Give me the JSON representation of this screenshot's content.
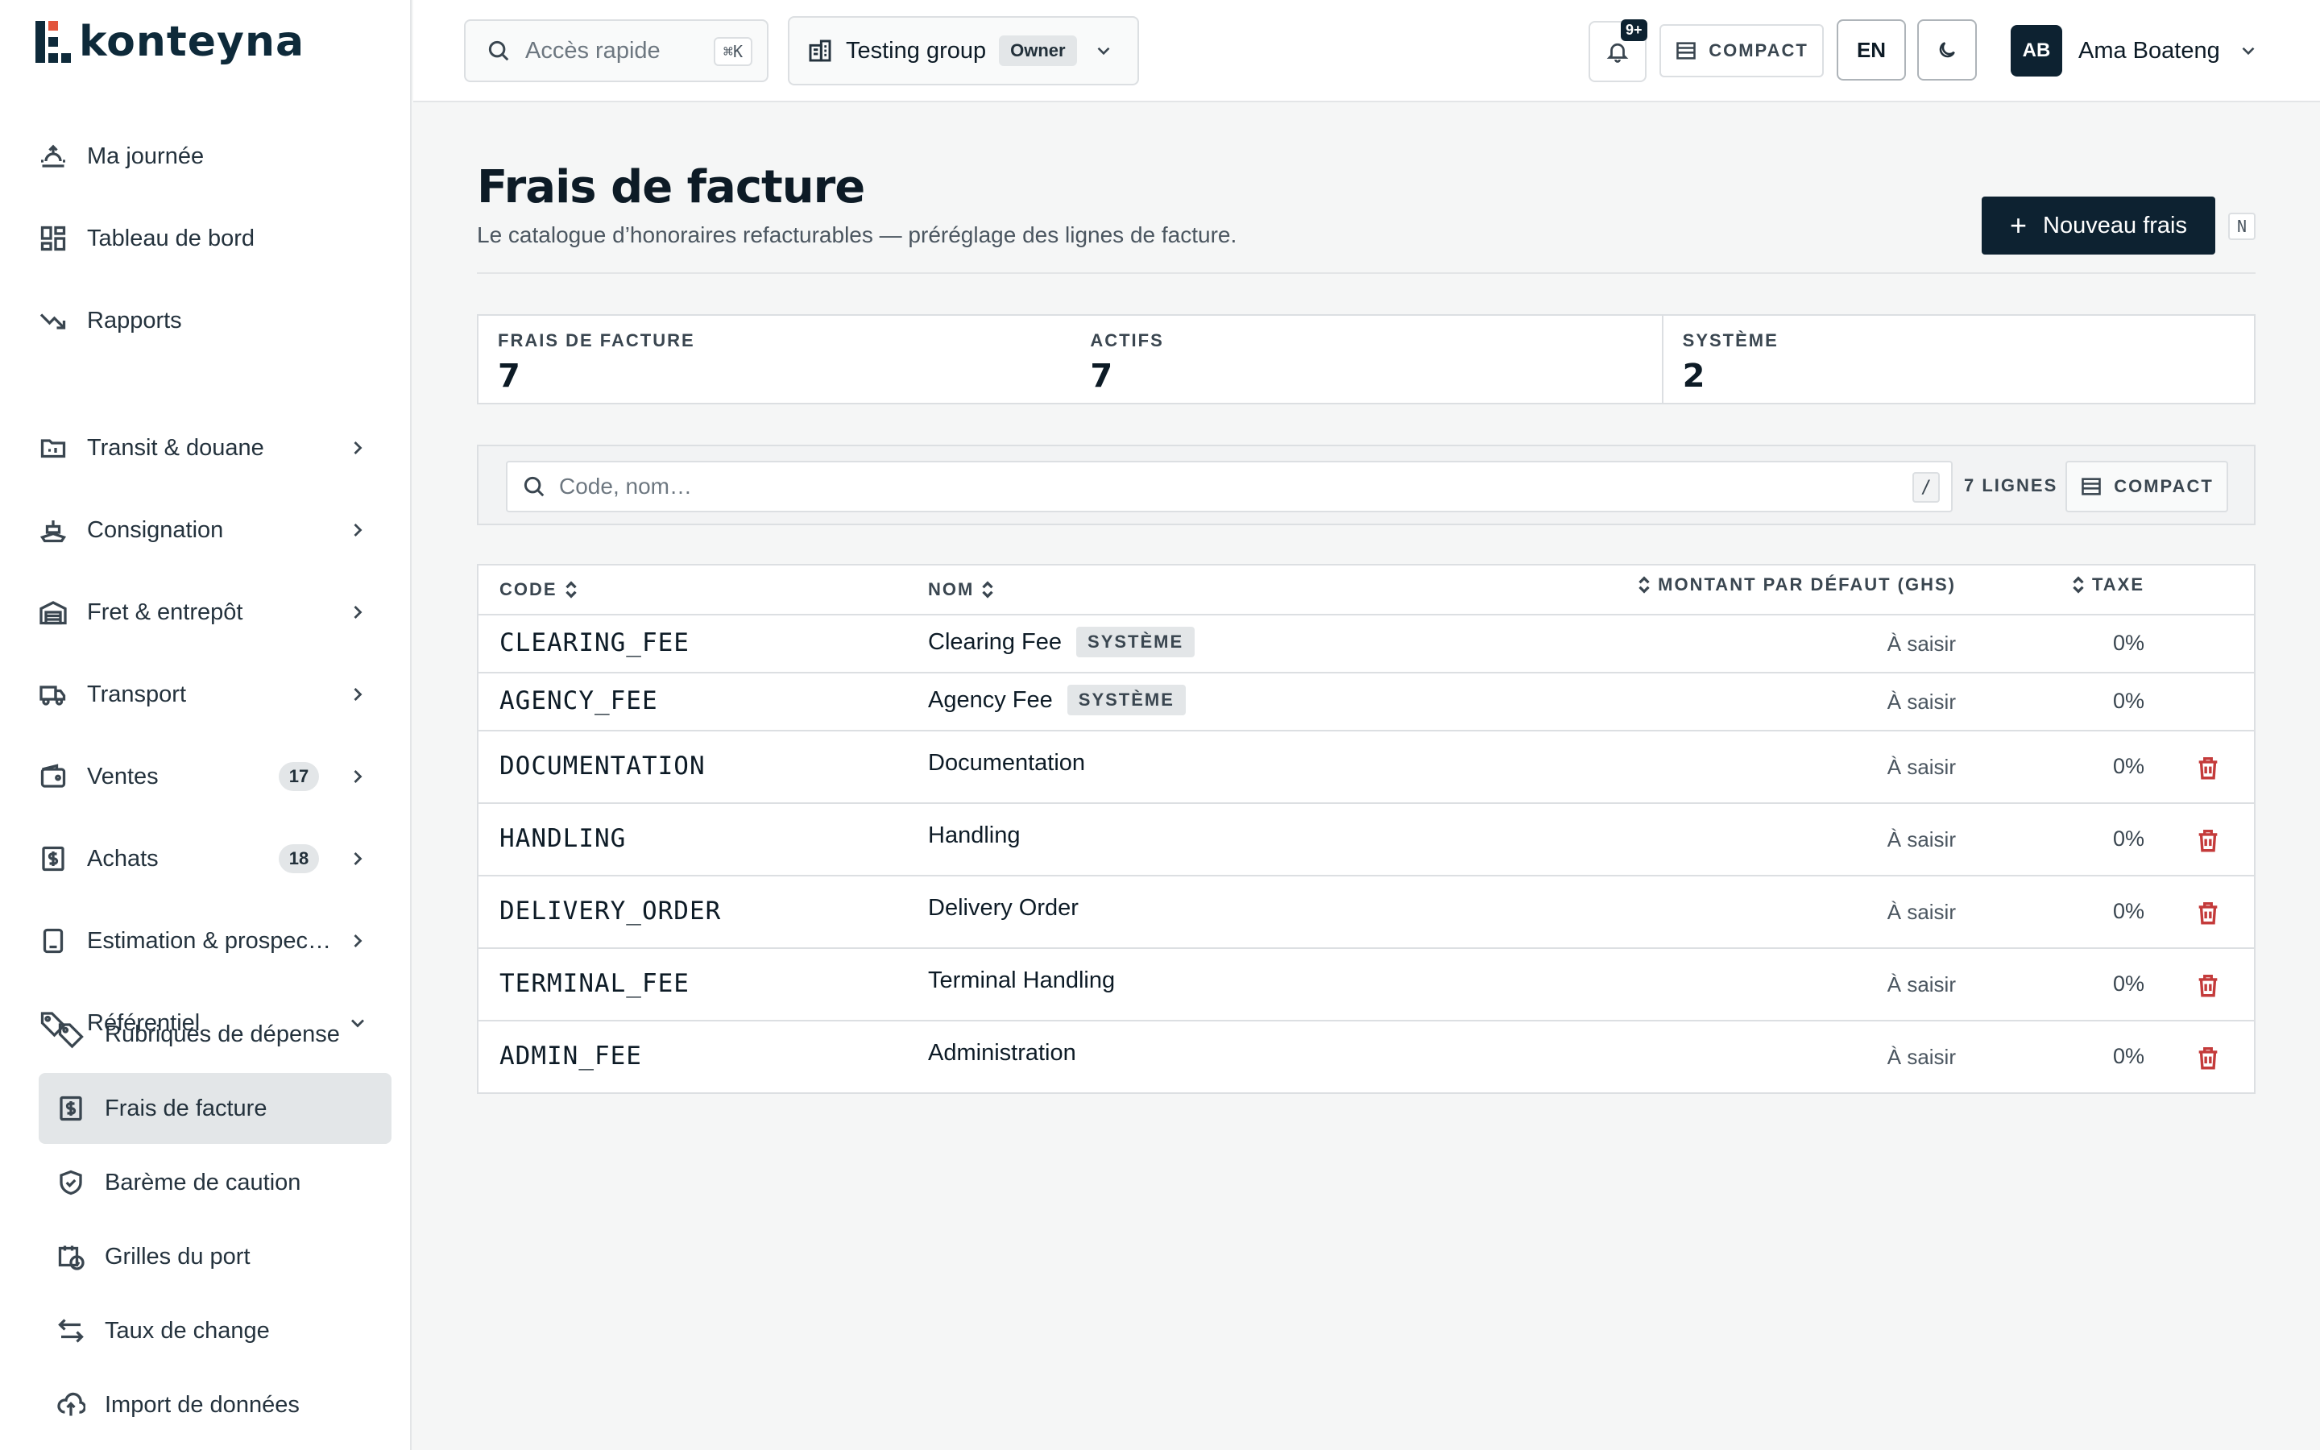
{
  "brand": {
    "name": "konteyna"
  },
  "sidebar": {
    "items": [
      {
        "label": "Ma journée",
        "icon": "sunrise-icon"
      },
      {
        "label": "Tableau de bord",
        "icon": "dashboard-icon"
      },
      {
        "label": "Rapports",
        "icon": "trend-down-icon"
      },
      {
        "label": "Transit & douane",
        "icon": "folder-icon"
      },
      {
        "label": "Consignation",
        "icon": "ship-icon"
      },
      {
        "label": "Fret & entrepôt",
        "icon": "warehouse-icon"
      },
      {
        "label": "Transport",
        "icon": "truck-icon"
      },
      {
        "label": "Ventes",
        "icon": "wallet-icon",
        "badge": "17"
      },
      {
        "label": "Achats",
        "icon": "dollar-doc-icon",
        "badge": "18"
      },
      {
        "label": "Estimation & prospec…",
        "icon": "calculator-icon"
      },
      {
        "label": "Référentiel",
        "icon": "tag-icon"
      }
    ],
    "sub_items": [
      {
        "label": "Rubriques de dépense",
        "icon": "tag-icon"
      },
      {
        "label": "Frais de facture",
        "icon": "dollar-doc-icon",
        "active": true
      },
      {
        "label": "Barème de caution",
        "icon": "shield-check-icon"
      },
      {
        "label": "Grilles du port",
        "icon": "calendar-clock-icon"
      },
      {
        "label": "Taux de change",
        "icon": "arrows-swap-icon"
      },
      {
        "label": "Import de données",
        "icon": "cloud-upload-icon"
      }
    ]
  },
  "topbar": {
    "quick_access_placeholder": "Accès rapide",
    "quick_access_shortcut": "⌘K",
    "group_name": "Testing group",
    "group_role": "Owner",
    "notifications_badge": "9+",
    "compact_label": "COMPACT",
    "language": "EN",
    "user_initials": "AB",
    "user_name": "Ama Boateng"
  },
  "page": {
    "title": "Frais de facture",
    "subtitle": "Le catalogue d’honoraires refacturables — préréglage des lignes de facture.",
    "new_button": "Nouveau frais",
    "new_shortcut": "N"
  },
  "stats": [
    {
      "label": "FRAIS DE FACTURE",
      "value": "7"
    },
    {
      "label": "ACTIFS",
      "value": "7"
    },
    {
      "label": "SYSTÈME",
      "value": "2"
    }
  ],
  "filter": {
    "search_placeholder": "Code, nom…",
    "search_shortcut": "/",
    "rows_label": "7 LIGNES",
    "compact_label": "COMPACT"
  },
  "table": {
    "columns": {
      "code": "CODE",
      "name": "NOM",
      "amount": "MONTANT PAR DÉFAUT (GHS)",
      "tax": "TAXE"
    },
    "rows": [
      {
        "code": "CLEARING_FEE",
        "name": "Clearing Fee",
        "badge": "SYSTÈME",
        "amount": "À saisir",
        "tax": "0%",
        "deletable": false
      },
      {
        "code": "AGENCY_FEE",
        "name": "Agency Fee",
        "badge": "SYSTÈME",
        "amount": "À saisir",
        "tax": "0%",
        "deletable": false
      },
      {
        "code": "DOCUMENTATION",
        "name": "Documentation",
        "badge": "",
        "amount": "À saisir",
        "tax": "0%",
        "deletable": true
      },
      {
        "code": "HANDLING",
        "name": "Handling",
        "badge": "",
        "amount": "À saisir",
        "tax": "0%",
        "deletable": true
      },
      {
        "code": "DELIVERY_ORDER",
        "name": "Delivery Order",
        "badge": "",
        "amount": "À saisir",
        "tax": "0%",
        "deletable": true
      },
      {
        "code": "TERMINAL_FEE",
        "name": "Terminal Handling",
        "badge": "",
        "amount": "À saisir",
        "tax": "0%",
        "deletable": true
      },
      {
        "code": "ADMIN_FEE",
        "name": "Administration",
        "badge": "",
        "amount": "À saisir",
        "tax": "0%",
        "deletable": true
      }
    ]
  }
}
